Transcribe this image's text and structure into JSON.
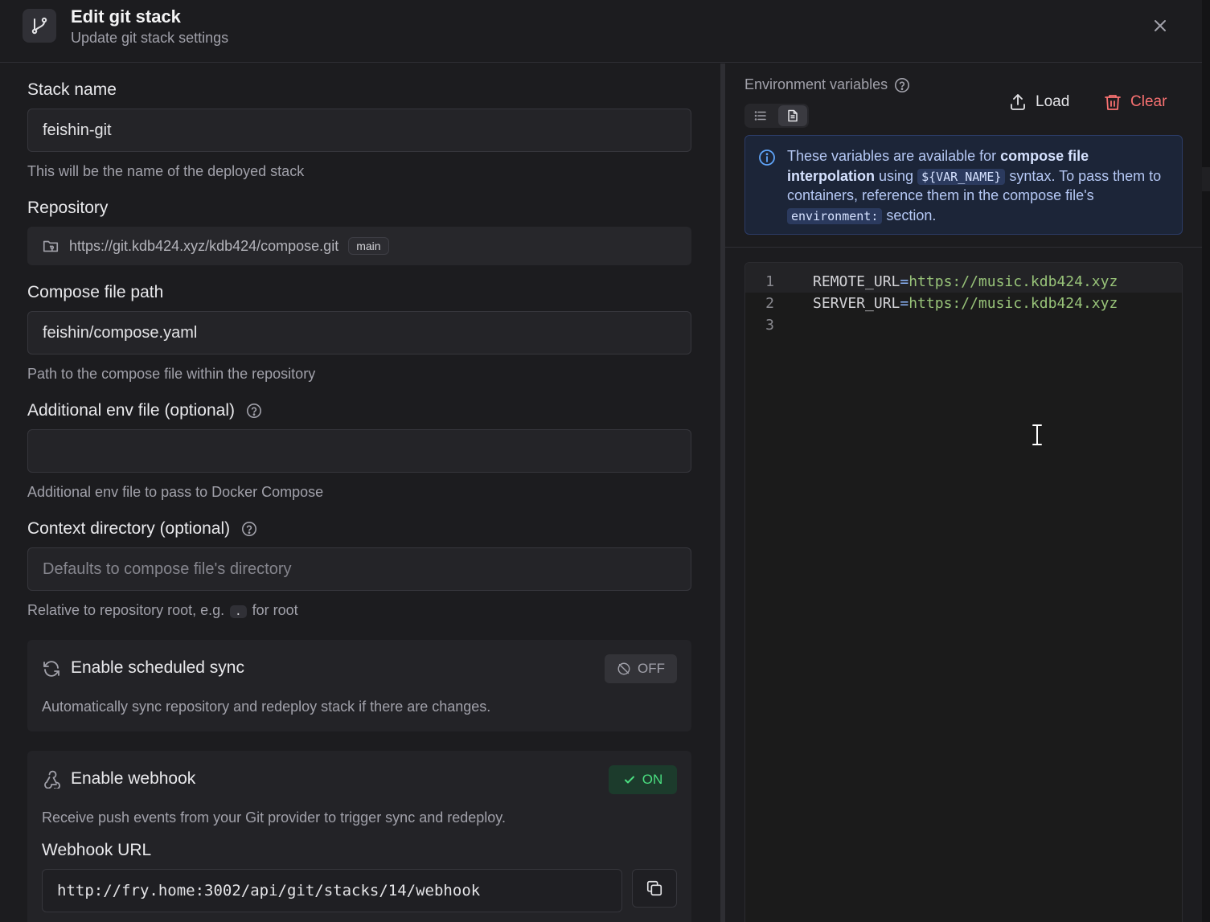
{
  "header": {
    "title": "Edit git stack",
    "subtitle": "Update git stack settings"
  },
  "form": {
    "stack_name": {
      "label": "Stack name",
      "value": "feishin-git",
      "help": "This will be the name of the deployed stack"
    },
    "repository": {
      "label": "Repository",
      "url": "https://git.kdb424.xyz/kdb424/compose.git",
      "branch": "main"
    },
    "compose_path": {
      "label": "Compose file path",
      "value": "feishin/compose.yaml",
      "help": "Path to the compose file within the repository"
    },
    "env_file": {
      "label": "Additional env file (optional)",
      "value": "",
      "help": "Additional env file to pass to Docker Compose"
    },
    "context_dir": {
      "label": "Context directory (optional)",
      "placeholder": "Defaults to compose file's directory",
      "help_before": "Relative to repository root, e.g.",
      "help_code": ".",
      "help_after": "for root"
    },
    "scheduled_sync": {
      "title": "Enable scheduled sync",
      "state": "OFF",
      "description": "Automatically sync repository and redeploy stack if there are changes."
    },
    "webhook": {
      "title": "Enable webhook",
      "state": "ON",
      "description": "Receive push events from your Git provider to trigger sync and redeploy.",
      "url_label": "Webhook URL",
      "url": "http://fry.home:3002/api/git/stacks/14/webhook"
    }
  },
  "env_panel": {
    "title": "Environment variables",
    "load_label": "Load",
    "clear_label": "Clear",
    "info": {
      "t1": "These variables are available for",
      "b1": "compose file interpolation",
      "t2": "using",
      "c1": "${VAR_NAME}",
      "t3": "syntax. To pass them to containers, reference them in the compose file's",
      "c2": "environment:",
      "t4": "section."
    },
    "lines": [
      {
        "n": "1",
        "key": "REMOTE_URL",
        "eq": "=",
        "val": "https://music.kdb424.xyz"
      },
      {
        "n": "2",
        "key": "SERVER_URL",
        "eq": "=",
        "val": "https://music.kdb424.xyz"
      },
      {
        "n": "3",
        "key": "",
        "eq": "",
        "val": ""
      }
    ]
  },
  "colors": {
    "background": "#1c1c1f",
    "accent_green": "#4ade80",
    "danger": "#f87171",
    "info_blue": "#60a5fa"
  },
  "icons": [
    "git-branch-icon",
    "close-icon",
    "help-circle-icon",
    "folder-git-icon",
    "refresh-icon",
    "sync-off-icon",
    "webhook-icon",
    "check-icon",
    "copy-icon",
    "list-icon",
    "file-text-icon",
    "upload-icon",
    "trash-icon",
    "info-icon",
    "text-cursor-icon"
  ]
}
